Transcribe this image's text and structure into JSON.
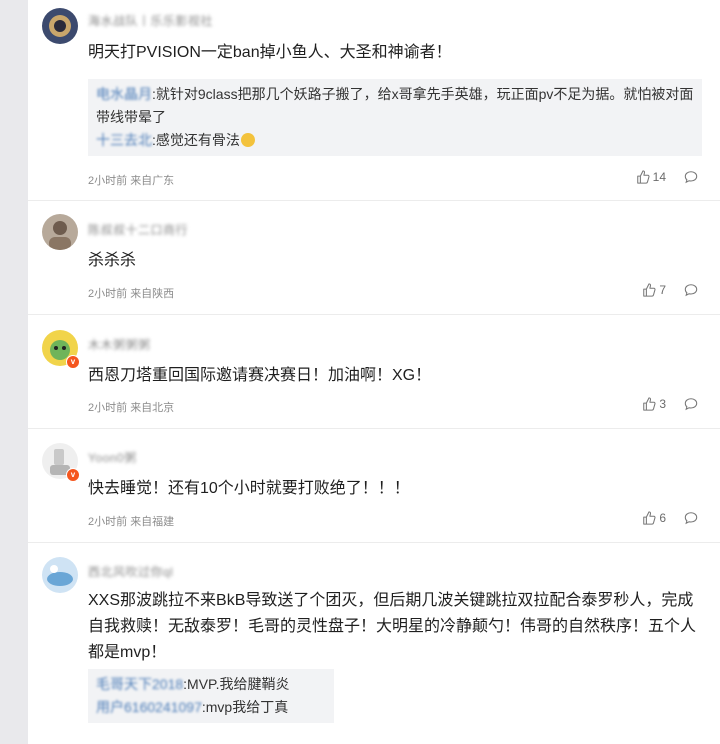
{
  "comments": [
    {
      "username": "海水战队丨乐乐影视社",
      "text": "明天打PVISION一定ban掉小鱼人、大圣和神谕者！",
      "replies": [
        {
          "name": "电水晶月",
          "text": ":就针对9class把那几个妖路子搬了，给x哥拿先手英雄，玩正面pv不足为据。就怕被对面带线带晕了"
        },
        {
          "name": "十三去北",
          "text": ":感觉还有骨法"
        }
      ],
      "time": "2小时前",
      "location": "来自广东",
      "likes": "14"
    },
    {
      "username": "陈叔叔十二口商行",
      "text": "杀杀杀",
      "replies": [],
      "time": "2小时前",
      "location": "来自陕西",
      "likes": "7"
    },
    {
      "username": "木木粥粥粥",
      "text": "西恩刀塔重回国际邀请赛决赛日！加油啊！XG！",
      "replies": [],
      "time": "2小时前",
      "location": "来自北京",
      "likes": "3"
    },
    {
      "username": "Yoon0粥",
      "text": "快去睡觉！还有10个小时就要打败绝了！！！",
      "replies": [],
      "time": "2小时前",
      "location": "来自福建",
      "likes": "6"
    },
    {
      "username": "西北风吹过你ql",
      "text": "XXS那波跳拉不来BkB导致送了个团灭，但后期几波关键跳拉双拉配合泰罗秒人，完成自我救赎！无敌泰罗！毛哥的灵性盘子！大明星的冷静颠勺！伟哥的自然秩序！五个人都是mvp！",
      "replies": [
        {
          "name": "毛哥天下2018",
          "text": ":MVP.我给腱鞘炎"
        },
        {
          "name": "用户6160241097",
          "text": ":mvp我给丁真"
        }
      ],
      "time": "",
      "location": "",
      "likes": ""
    }
  ],
  "icons": {
    "like": "thumbs-up-icon",
    "comment": "comment-bubble-icon"
  },
  "colors": {
    "reply_name": "#4a7bb7",
    "vip_badge": "#f5561e",
    "reply_bg": "#f2f3f5"
  }
}
